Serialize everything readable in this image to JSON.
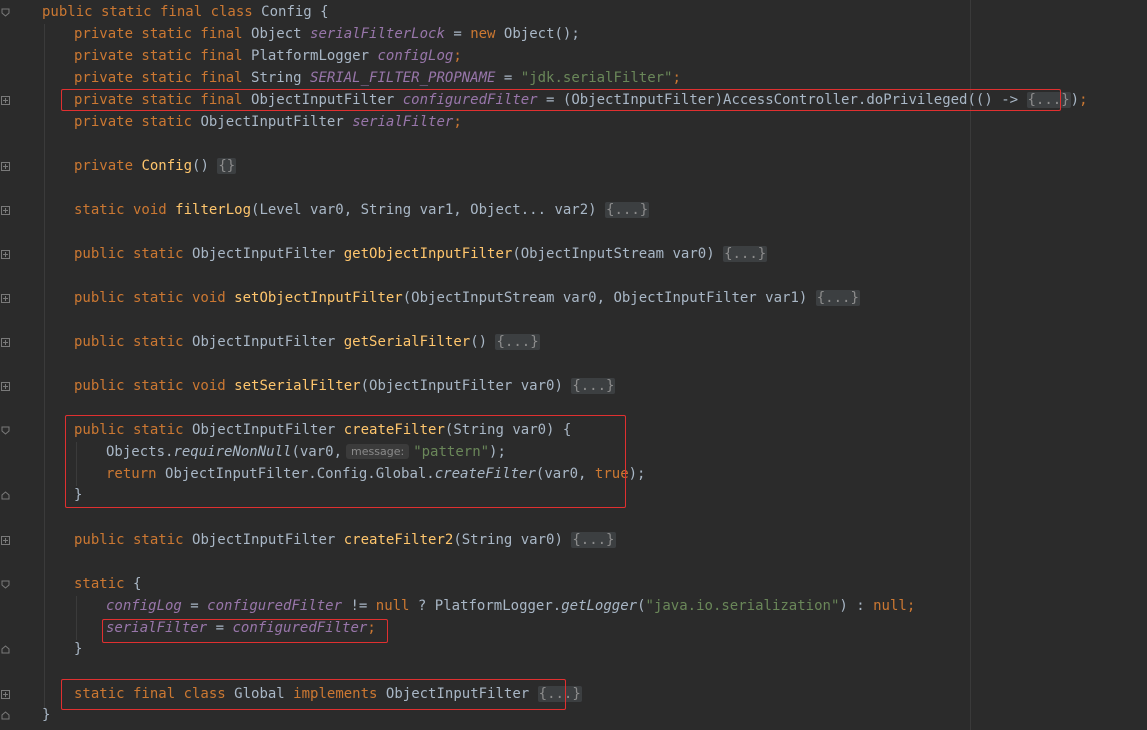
{
  "editor": {
    "inlay_hint": "message:",
    "string_literals": [
      "\"jdk.serialFilter\"",
      "\"pattern\"",
      "\"java.io.serialization\""
    ],
    "folded_placeholder": "{...}",
    "empty_body": "{}"
  },
  "code": {
    "class_header": {
      "modifiers": "public static final class",
      "name": "Config",
      "brace": "{"
    },
    "fields": [
      {
        "modifiers": "private static final",
        "type": "Object",
        "name": "serialFilterLock",
        "init_kw": "new",
        "init_rest": "Object();"
      },
      {
        "modifiers": "private static final",
        "type": "PlatformLogger",
        "name": "configLog"
      },
      {
        "modifiers": "private static final",
        "type": "String",
        "name": "SERIAL_FILTER_PROPNAME"
      },
      {
        "modifiers": "private static final",
        "type": "ObjectInputFilter",
        "name": "configuredFilter",
        "init": "(ObjectInputFilter)AccessController.doPrivileged(() ->"
      },
      {
        "modifiers": "private static",
        "type": "ObjectInputFilter",
        "name": "serialFilter"
      }
    ],
    "constructor": {
      "modifiers": "private",
      "name": "Config"
    },
    "methods": [
      {
        "modifiers": "static void",
        "name": "filterLog",
        "params": "(Level var0, String var1, Object... var2)"
      },
      {
        "modifiers": "public static",
        "type": "ObjectInputFilter",
        "name": "getObjectInputFilter",
        "params": "(ObjectInputStream var0)"
      },
      {
        "modifiers": "public static void",
        "name": "setObjectInputFilter",
        "params": "(ObjectInputStream var0, ObjectInputFilter var1)"
      },
      {
        "modifiers": "public static",
        "type": "ObjectInputFilter",
        "name": "getSerialFilter",
        "params": "()"
      },
      {
        "modifiers": "public static void",
        "name": "setSerialFilter",
        "params": "(ObjectInputFilter var0)"
      }
    ],
    "create_filter": {
      "modifiers": "public static",
      "type": "ObjectInputFilter",
      "name": "createFilter",
      "params": "(String var0) {",
      "body1_prefix": "Objects.",
      "body1_call": "requireNonNull",
      "body1_arg": "(var0,",
      "body1_end": ");",
      "body2_kw": "return",
      "body2_rest": "ObjectInputFilter.Config.Global.",
      "body2_call": "createFilter",
      "body2_args": "(var0,",
      "body2_true": "true",
      "body2_end": ");",
      "close": "}"
    },
    "create_filter2": {
      "modifiers": "public static",
      "type": "ObjectInputFilter",
      "name": "createFilter2",
      "params": "(String var0)"
    },
    "static_block": {
      "kw": "static",
      "open": "{",
      "line1_a": "configLog",
      "line1_eq": "=",
      "line1_b": "configuredFilter",
      "line1_op": "!=",
      "line1_null": "null",
      "line1_q": "? PlatformLogger.",
      "line1_call": "getLogger",
      "line1_colon": ") :",
      "line1_null2": "null",
      "line1_semi": ";",
      "line2_a": "serialFilter",
      "line2_eq": "=",
      "line2_b": "configuredFilter",
      "line2_semi": ";",
      "close": "}"
    },
    "global_class": {
      "modifiers": "static final class",
      "name": "Global",
      "implements": "implements",
      "iface": "ObjectInputFilter"
    },
    "class_close": "}"
  }
}
